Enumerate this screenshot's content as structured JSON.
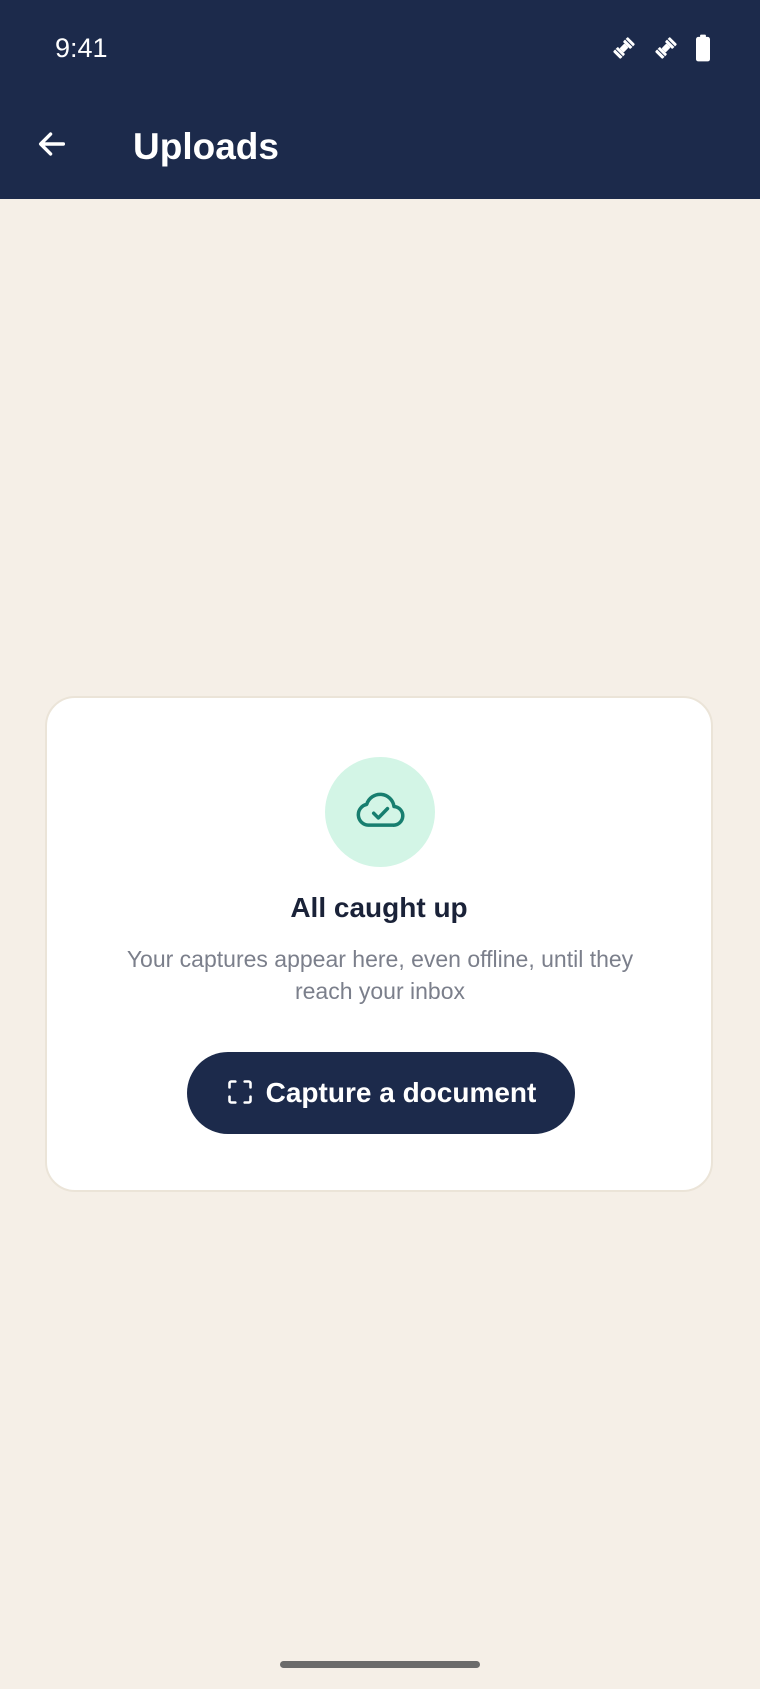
{
  "status_bar": {
    "time": "9:41",
    "icons": [
      "satellite-icon",
      "satellite-icon",
      "battery-icon"
    ]
  },
  "app_bar": {
    "back_icon": "arrow-left-icon",
    "title": "Uploads"
  },
  "empty_state": {
    "icon": "cloud-check-icon",
    "title": "All caught up",
    "message": "Your captures appear here, even offline, until they reach your inbox",
    "action": {
      "icon": "scan-frame-icon",
      "label": "Capture a document"
    }
  },
  "colors": {
    "app_bar": "#1c2a4b",
    "background": "#f5efe7",
    "card": "#ffffff",
    "icon_circle": "#d3f5e6",
    "icon_accent": "#177e6f",
    "button": "#1c2a4b"
  }
}
